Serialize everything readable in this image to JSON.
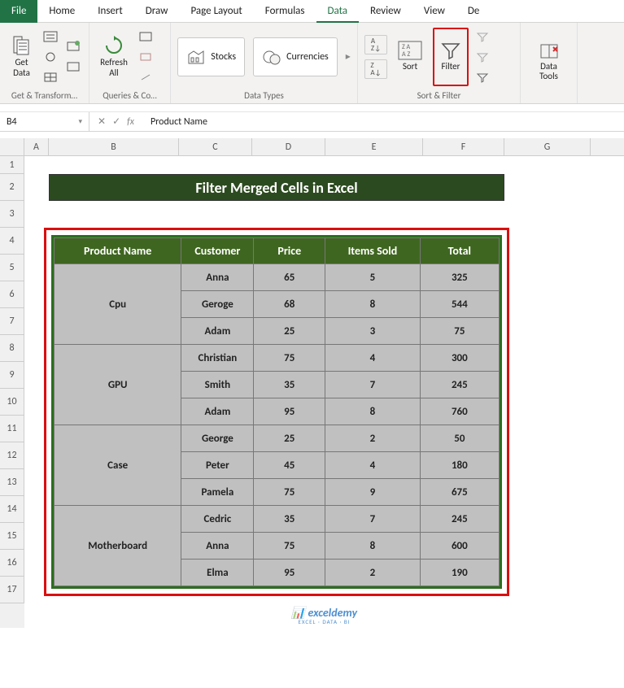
{
  "tabs": {
    "file": "File",
    "home": "Home",
    "insert": "Insert",
    "draw": "Draw",
    "page_layout": "Page Layout",
    "formulas": "Formulas",
    "data": "Data",
    "review": "Review",
    "view": "View",
    "de": "De"
  },
  "ribbon": {
    "g1_label": "Get & Transform…",
    "get_data": "Get\nData",
    "g2_label": "Queries & Co…",
    "refresh_all": "Refresh\nAll",
    "g3_label": "Data Types",
    "stocks": "Stocks",
    "currencies": "Currencies",
    "g4_label": "Sort & Filter",
    "sort": "Sort",
    "filter": "Filter",
    "g5_label": "",
    "data_tools": "Data\nTools"
  },
  "formula_bar": {
    "cell": "B4",
    "fx": "fx",
    "value": "Product Name"
  },
  "columns": [
    "A",
    "B",
    "C",
    "D",
    "E",
    "F",
    "G"
  ],
  "col_widths": {
    "A": 30,
    "B": 160,
    "C": 90,
    "D": 90,
    "E": 120,
    "F": 100,
    "G": 106
  },
  "row_labels": [
    "1",
    "2",
    "3",
    "4",
    "5",
    "6",
    "7",
    "8",
    "9",
    "10",
    "11",
    "12",
    "13",
    "14",
    "15",
    "16",
    "17"
  ],
  "title": "Filter Merged Cells in Excel",
  "headers": {
    "product": "Product Name",
    "customer": "Customer",
    "price": "Price",
    "items": "Items Sold",
    "total": "Total"
  },
  "rows": [
    {
      "product": "Cpu",
      "customer": "Anna",
      "price": "65",
      "items": "5",
      "total": "325"
    },
    {
      "product": "",
      "customer": "Geroge",
      "price": "68",
      "items": "8",
      "total": "544"
    },
    {
      "product": "",
      "customer": "Adam",
      "price": "25",
      "items": "3",
      "total": "75"
    },
    {
      "product": "GPU",
      "customer": "Christian",
      "price": "75",
      "items": "4",
      "total": "300"
    },
    {
      "product": "",
      "customer": "Smith",
      "price": "35",
      "items": "7",
      "total": "245"
    },
    {
      "product": "",
      "customer": "Adam",
      "price": "95",
      "items": "8",
      "total": "760"
    },
    {
      "product": "Case",
      "customer": "George",
      "price": "25",
      "items": "2",
      "total": "50"
    },
    {
      "product": "",
      "customer": "Peter",
      "price": "45",
      "items": "4",
      "total": "180"
    },
    {
      "product": "",
      "customer": "Pamela",
      "price": "75",
      "items": "9",
      "total": "675"
    },
    {
      "product": "Motherboard",
      "customer": "Cedric",
      "price": "35",
      "items": "7",
      "total": "245"
    },
    {
      "product": "",
      "customer": "Anna",
      "price": "75",
      "items": "8",
      "total": "600"
    },
    {
      "product": "",
      "customer": "Elma",
      "price": "95",
      "items": "2",
      "total": "190"
    }
  ],
  "watermark": {
    "name": "exceldemy",
    "sub": "EXCEL · DATA · BI"
  },
  "chart_data": {
    "type": "table",
    "title": "Filter Merged Cells in Excel",
    "columns": [
      "Product Name",
      "Customer",
      "Price",
      "Items Sold",
      "Total"
    ],
    "records": [
      [
        "Cpu",
        "Anna",
        65,
        5,
        325
      ],
      [
        "Cpu",
        "Geroge",
        68,
        8,
        544
      ],
      [
        "Cpu",
        "Adam",
        25,
        3,
        75
      ],
      [
        "GPU",
        "Christian",
        75,
        4,
        300
      ],
      [
        "GPU",
        "Smith",
        35,
        7,
        245
      ],
      [
        "GPU",
        "Adam",
        95,
        8,
        760
      ],
      [
        "Case",
        "George",
        25,
        2,
        50
      ],
      [
        "Case",
        "Peter",
        45,
        4,
        180
      ],
      [
        "Case",
        "Pamela",
        75,
        9,
        675
      ],
      [
        "Motherboard",
        "Cedric",
        35,
        7,
        245
      ],
      [
        "Motherboard",
        "Anna",
        75,
        8,
        600
      ],
      [
        "Motherboard",
        "Elma",
        95,
        2,
        190
      ]
    ]
  }
}
